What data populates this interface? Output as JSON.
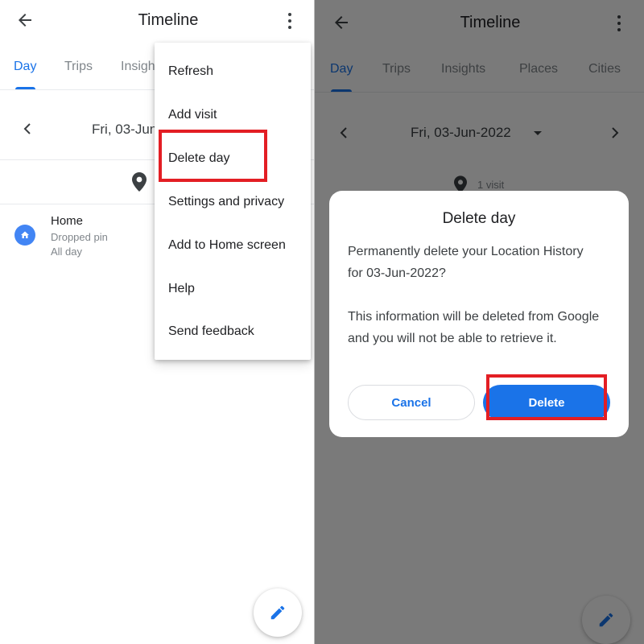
{
  "accent_color": "#1a73e8",
  "highlight_color": "#e31e24",
  "left": {
    "header": {
      "title": "Timeline",
      "back_icon": "arrow-back-icon",
      "more_icon": "more-vert-icon"
    },
    "tabs": [
      {
        "label": "Day",
        "active": true
      },
      {
        "label": "Trips",
        "active": false
      },
      {
        "label": "Insights",
        "active": false
      }
    ],
    "date": {
      "label": "Fri, 03-Jun-2022",
      "prev_icon": "chevron-left-icon"
    },
    "summary": {
      "icon": "location-pin-icon"
    },
    "items": [
      {
        "title": "Home",
        "subtitle": "Dropped pin",
        "time": "All day",
        "icon": "home-icon"
      }
    ],
    "menu": {
      "items": [
        {
          "label": "Refresh"
        },
        {
          "label": "Add visit"
        },
        {
          "label": "Delete day",
          "highlighted": true
        },
        {
          "label": "Settings and privacy"
        },
        {
          "label": "Add to Home screen"
        },
        {
          "label": "Help"
        },
        {
          "label": "Send feedback"
        }
      ]
    },
    "fab": {
      "icon": "edit-pencil-icon"
    }
  },
  "right": {
    "header": {
      "title": "Timeline",
      "back_icon": "arrow-back-icon",
      "more_icon": "more-vert-icon"
    },
    "tabs": [
      {
        "label": "Day",
        "active": true
      },
      {
        "label": "Trips",
        "active": false
      },
      {
        "label": "Insights",
        "active": false
      },
      {
        "label": "Places",
        "active": false
      },
      {
        "label": "Cities",
        "active": false
      }
    ],
    "date": {
      "label": "Fri, 03-Jun-2022",
      "prev_icon": "chevron-left-icon",
      "next_icon": "chevron-right-icon",
      "dropdown_icon": "caret-down-icon"
    },
    "summary": {
      "icon": "location-pin-icon",
      "label": "1 visit"
    },
    "dialog": {
      "title": "Delete day",
      "body_1": "Permanently delete your Location History for 03-Jun-2022?",
      "body_2": "This information will be deleted from Google and you will not be able to retrieve it.",
      "cancel_label": "Cancel",
      "delete_label": "Delete"
    },
    "fab": {
      "icon": "edit-pencil-icon"
    }
  }
}
